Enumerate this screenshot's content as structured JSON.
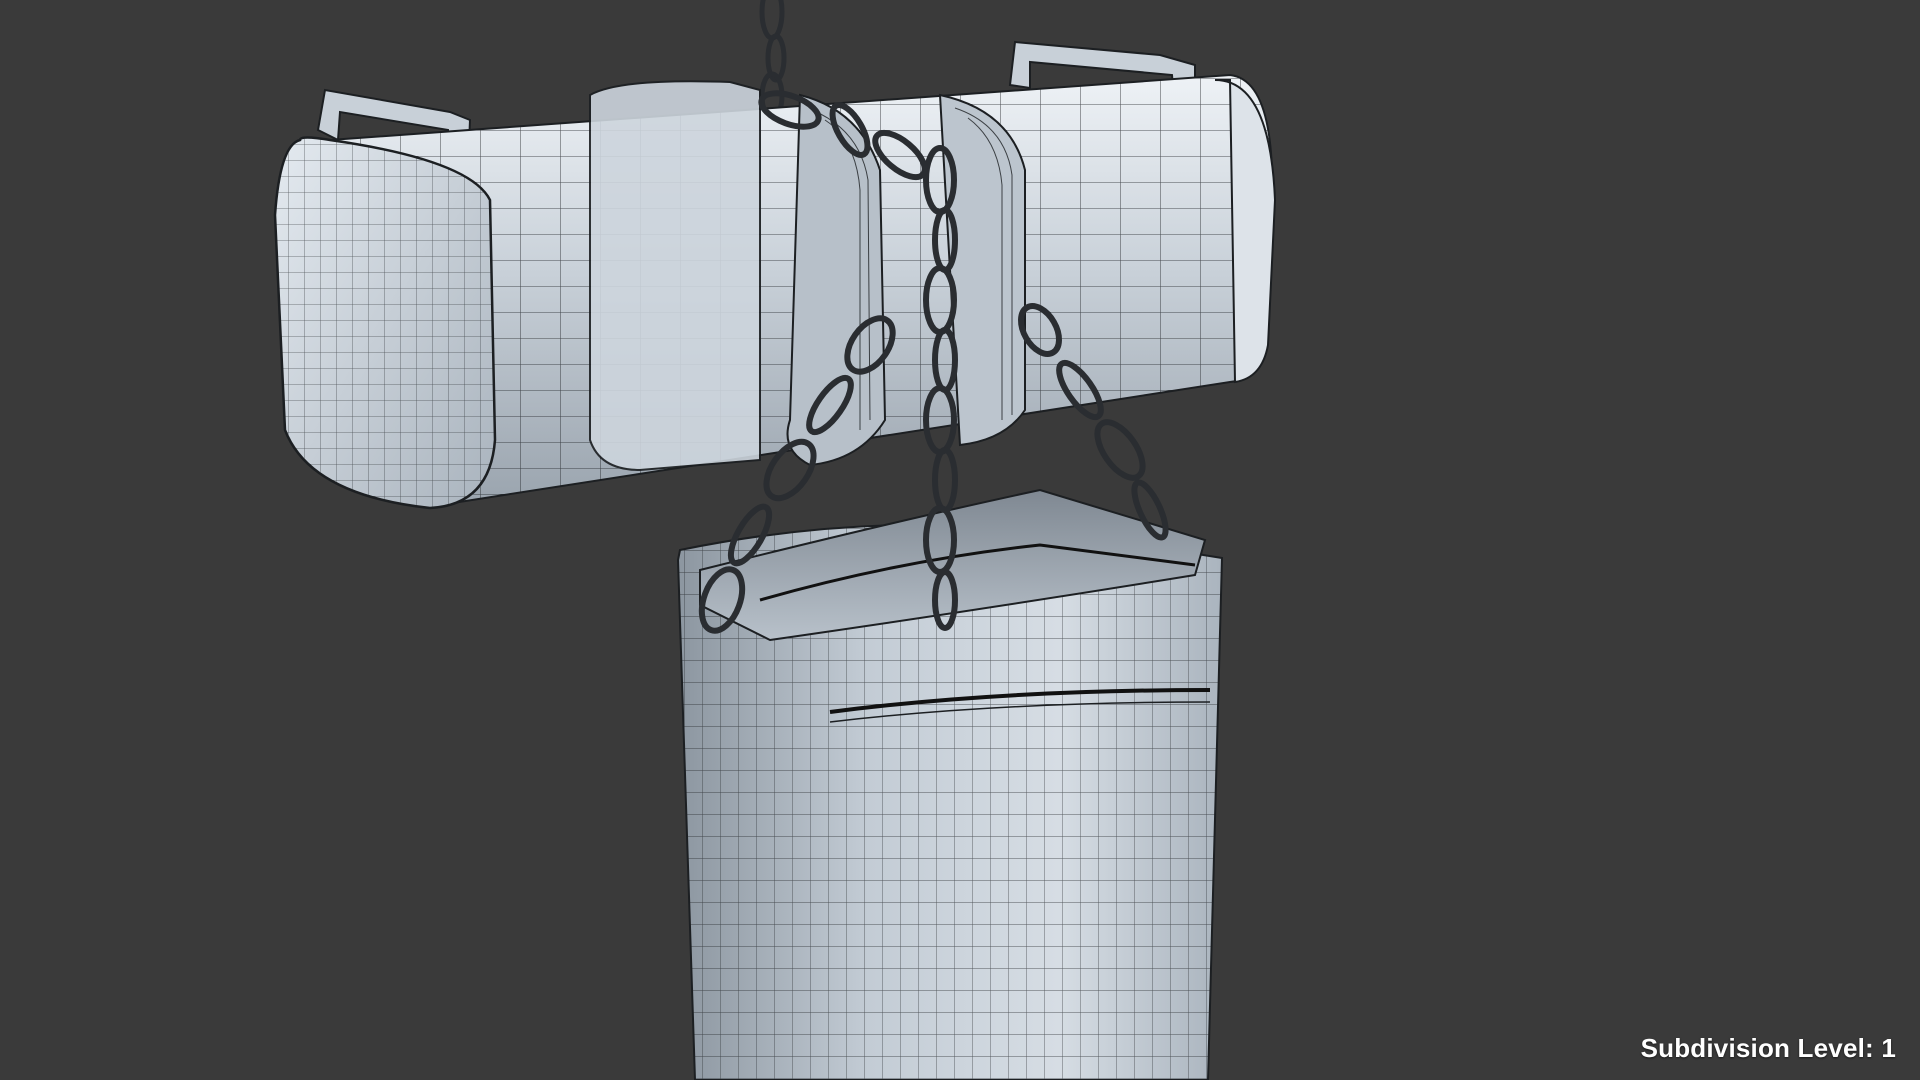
{
  "viewport": {
    "background": "#3a3a3a",
    "subdivision_label": "Subdivision Level: 1"
  },
  "scene": {
    "model": "chain-hoist-wireframe",
    "shading_color": "#b9c3cc",
    "wire_color": "#1c1f22",
    "objects": [
      "hoist-housing-icon",
      "carry-handle-icon",
      "chain-icon",
      "chain-bag-icon"
    ]
  }
}
